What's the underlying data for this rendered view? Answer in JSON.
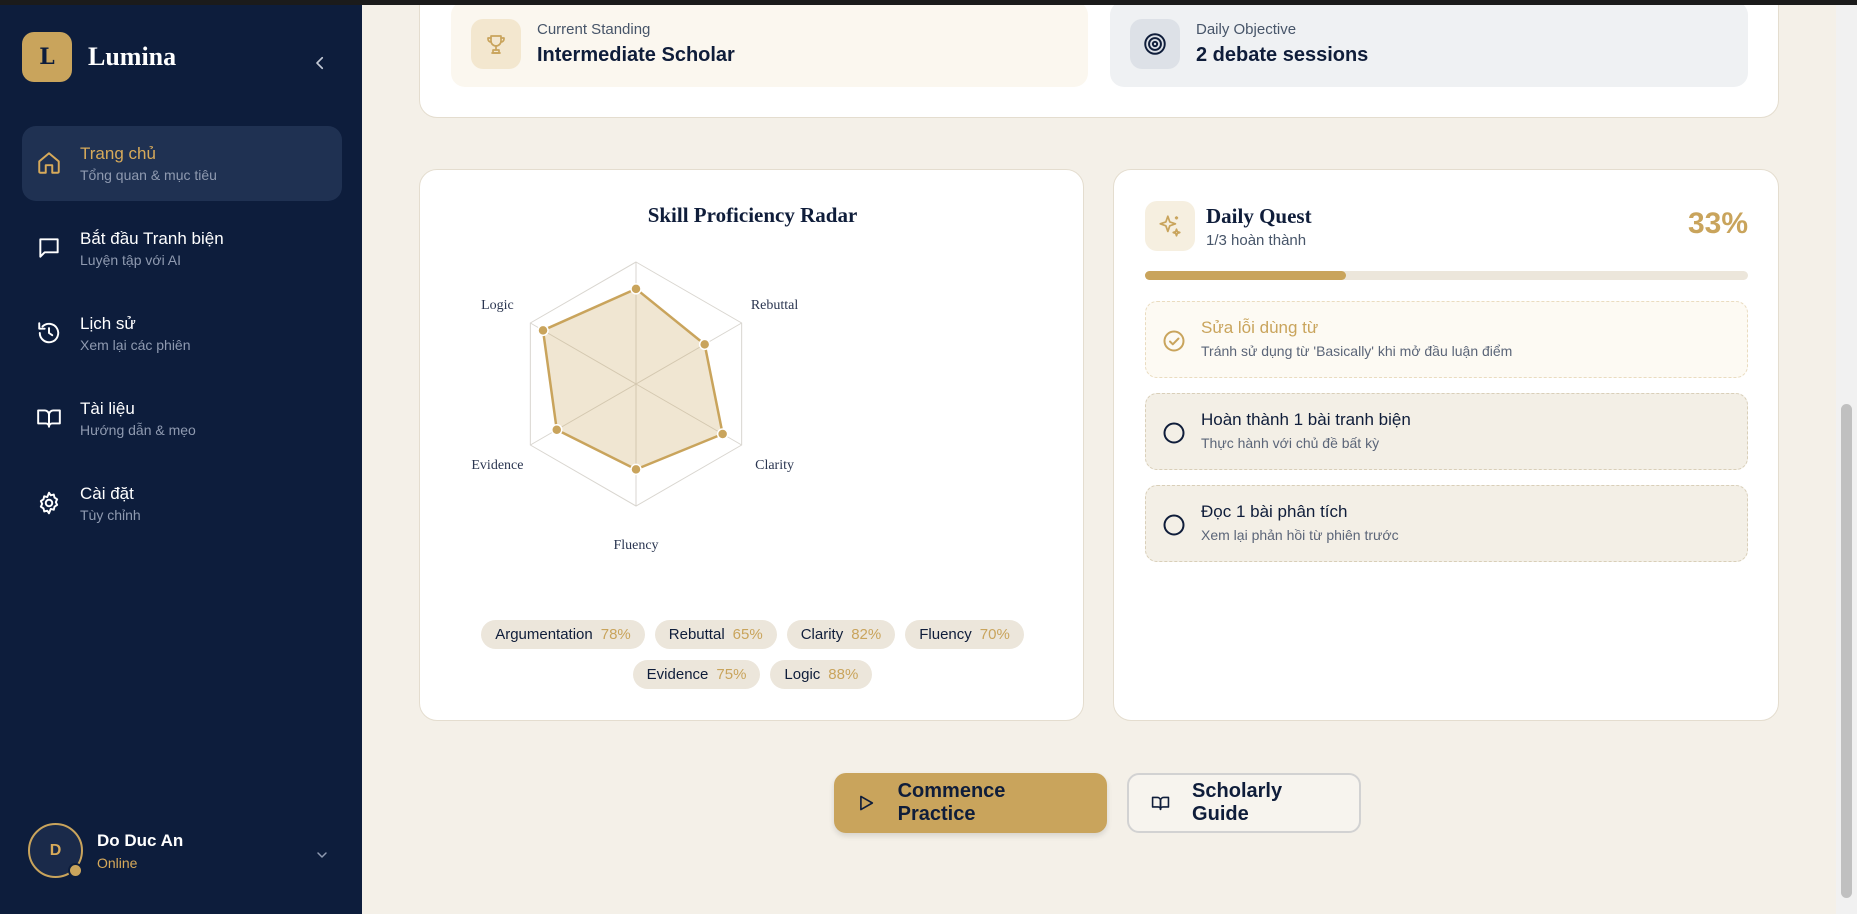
{
  "brand": {
    "logo_letter": "L",
    "name": "Lumina"
  },
  "nav": {
    "items": [
      {
        "title": "Trang chủ",
        "subtitle": "Tổng quan & mục tiêu",
        "icon": "home-icon",
        "active": true
      },
      {
        "title": "Bắt đầu Tranh biện",
        "subtitle": "Luyện tập với AI",
        "icon": "message-square-icon"
      },
      {
        "title": "Lịch sử",
        "subtitle": "Xem lại các phiên",
        "icon": "history-icon"
      },
      {
        "title": "Tài liệu",
        "subtitle": "Hướng dẫn & mẹo",
        "icon": "book-open-icon"
      },
      {
        "title": "Cài đặt",
        "subtitle": "Tùy chỉnh",
        "icon": "gear-icon"
      }
    ]
  },
  "user": {
    "initial": "D",
    "name": "Do Duc An",
    "status": "Online"
  },
  "stats": {
    "standing": {
      "label": "Current Standing",
      "value": "Intermediate Scholar",
      "icon": "trophy-icon"
    },
    "objective": {
      "label": "Daily Objective",
      "value": "2 debate sessions",
      "icon": "target-icon"
    }
  },
  "radar": {
    "title": "Skill Proficiency Radar",
    "chips": [
      {
        "label": "Argumentation",
        "pct": "78%"
      },
      {
        "label": "Rebuttal",
        "pct": "65%"
      },
      {
        "label": "Clarity",
        "pct": "82%"
      },
      {
        "label": "Fluency",
        "pct": "70%"
      },
      {
        "label": "Evidence",
        "pct": "75%"
      },
      {
        "label": "Logic",
        "pct": "88%"
      }
    ]
  },
  "chart_data": {
    "type": "radar",
    "title": "Skill Proficiency Radar",
    "axes": [
      "Argumentation",
      "Rebuttal",
      "Clarity",
      "Fluency",
      "Evidence",
      "Logic"
    ],
    "values": [
      78,
      65,
      82,
      70,
      75,
      88
    ],
    "range": [
      0,
      100
    ],
    "rings": 5,
    "colors": {
      "fill": "#c9a45c",
      "stroke": "#c9a45c",
      "grid": "#d9d6d0"
    }
  },
  "quest": {
    "title": "Daily Quest",
    "subtitle": "1/3 hoàn thành",
    "percent_label": "33%",
    "progress": 0.333,
    "tasks": [
      {
        "title": "Sửa lỗi dùng từ",
        "subtitle": "Tránh sử dụng từ 'Basically' khi mở đầu luận điểm",
        "done": true
      },
      {
        "title": "Hoàn thành 1 bài tranh biện",
        "subtitle": "Thực hành với chủ đề bất kỳ",
        "done": false
      },
      {
        "title": "Đọc 1 bài phân tích",
        "subtitle": "Xem lại phản hồi từ phiên trước",
        "done": false
      }
    ]
  },
  "actions": {
    "primary": "Commence Practice",
    "secondary": "Scholarly Guide"
  },
  "colors": {
    "accent": "#c9a45c",
    "sidebar": "#0d1d3c",
    "background": "#f4f0e8"
  }
}
